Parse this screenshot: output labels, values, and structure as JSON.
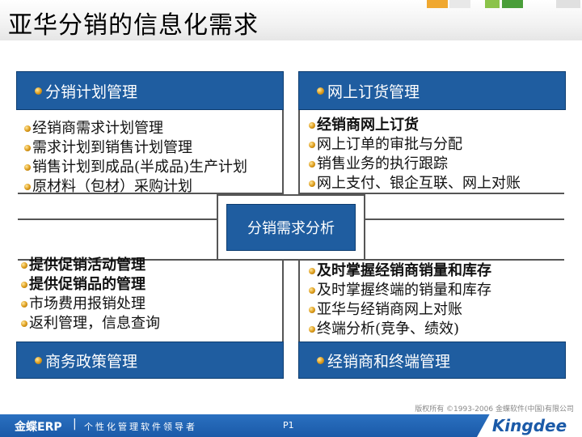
{
  "slide": {
    "title": "亚华分销的信息化需求",
    "center_label": "分销需求分析",
    "copyright": "版权所有 ©1993-2006 金蝶软件(中国)有限公司"
  },
  "quadrants": {
    "top_left": {
      "header": "分销计划管理",
      "items": [
        {
          "text": "经销商需求计划管理",
          "bold": false
        },
        {
          "text": "需求计划到销售计划管理",
          "bold": false
        },
        {
          "text": "销售计划到成品(半成品)生产计划",
          "bold": false
        },
        {
          "text": "原材料（包材）采购计划",
          "bold": false
        }
      ]
    },
    "top_right": {
      "header": "网上订货管理",
      "items": [
        {
          "text": "经销商网上订货",
          "bold": true
        },
        {
          "text": "网上订单的审批与分配",
          "bold": false
        },
        {
          "text": "销售业务的执行跟踪",
          "bold": false
        },
        {
          "text": "网上支付、银企互联、网上对账",
          "bold": false
        }
      ]
    },
    "bottom_left": {
      "header": "商务政策管理",
      "items": [
        {
          "text": "提供促销活动管理",
          "bold": true
        },
        {
          "text": "提供促销品的管理",
          "bold": true
        },
        {
          "text": "市场费用报销处理",
          "bold": false
        },
        {
          "text": "返利管理，信息查询",
          "bold": false
        }
      ]
    },
    "bottom_right": {
      "header": "经销商和终端管理",
      "items": [
        {
          "text": "及时掌握经销商销量和库存",
          "bold": true
        },
        {
          "text": "及时掌握终端的销量和库存",
          "bold": false
        },
        {
          "text": "亚华与经销商网上对账",
          "bold": false
        },
        {
          "text": "终端分析(竞争、绩效)",
          "bold": false
        }
      ]
    }
  },
  "footer": {
    "brand": "金蝶ERP",
    "separator": "|",
    "slogan": "个性化管理软件领导者",
    "page": "P1",
    "logo": "Kingdee"
  },
  "colors": {
    "header_blue": "#1f5da0",
    "footer_blue": "#1b5aa8",
    "bullet_gold": "#e0a020"
  },
  "icons": {
    "bullet": "gold-ball-bullet-icon"
  }
}
